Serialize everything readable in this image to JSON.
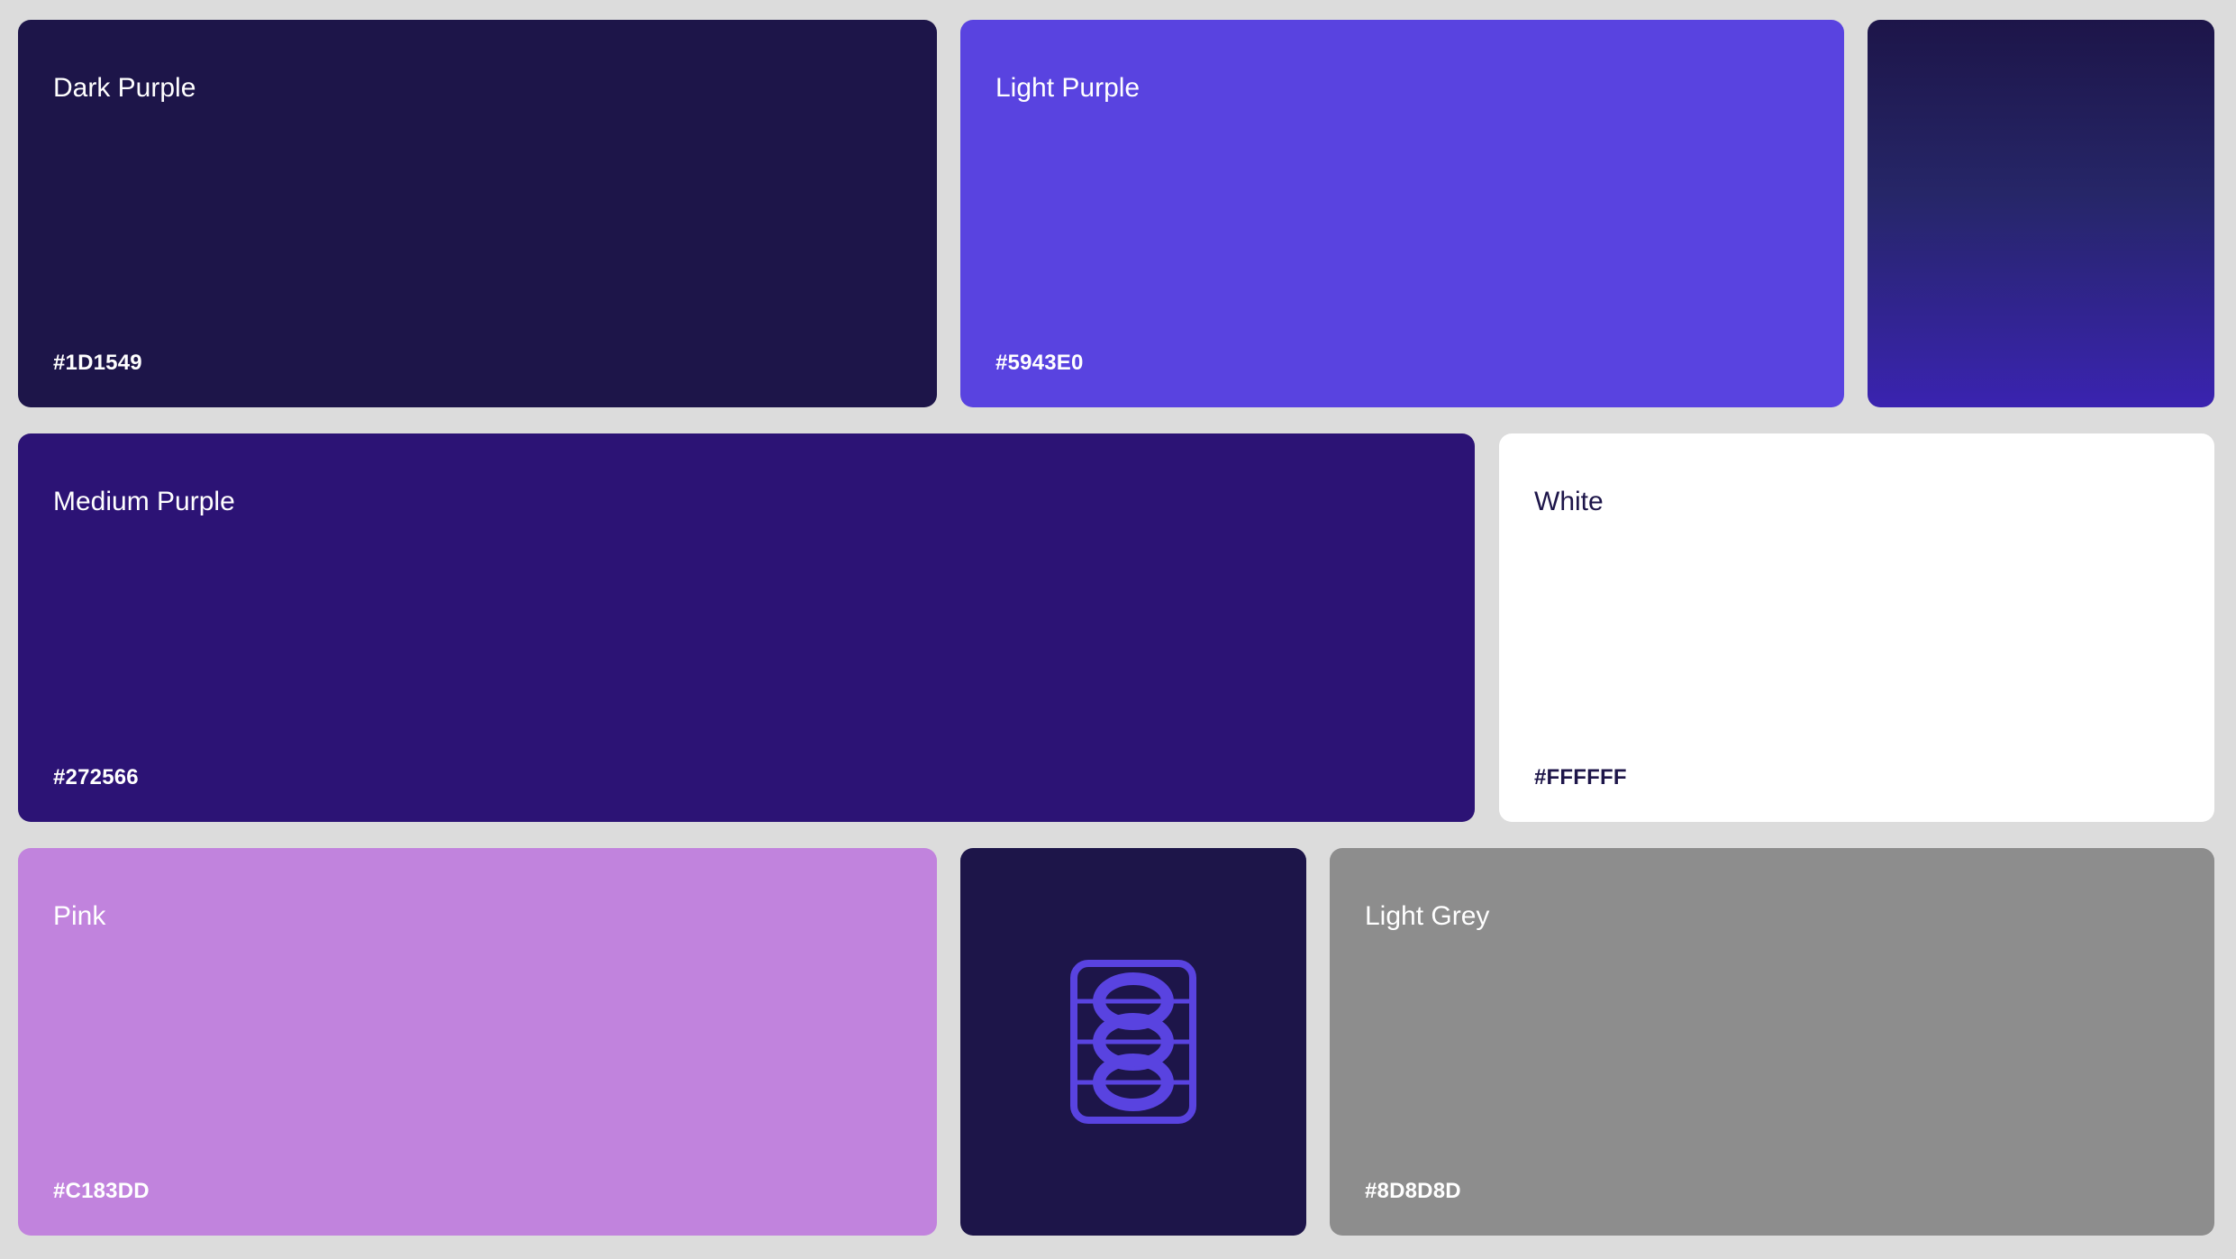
{
  "swatches": [
    {
      "name": "Dark Purple",
      "hex": "#1D1549",
      "color": "#1D1549"
    },
    {
      "name": "Light Purple",
      "hex": "#5943E0",
      "color": "#5943E0"
    },
    {
      "name": "Medium Purple",
      "hex": "#272566",
      "color": "#2C1375"
    },
    {
      "name": "White",
      "hex": "#FFFFFF",
      "color": "#FFFFFF"
    },
    {
      "name": "Pink",
      "hex": "#C183DD",
      "color": "#C183DD"
    },
    {
      "name": "Light Grey",
      "hex": "#8D8D8D",
      "color": "#8D8D8D"
    }
  ],
  "gradient_swatch": {
    "colors": [
      "#1D1549",
      "#262668",
      "#3A23B0"
    ]
  },
  "logo_tile": {
    "background": "#1D1549",
    "icon_color": "#5943E0",
    "icon": "stacked-circles-logo-icon"
  }
}
